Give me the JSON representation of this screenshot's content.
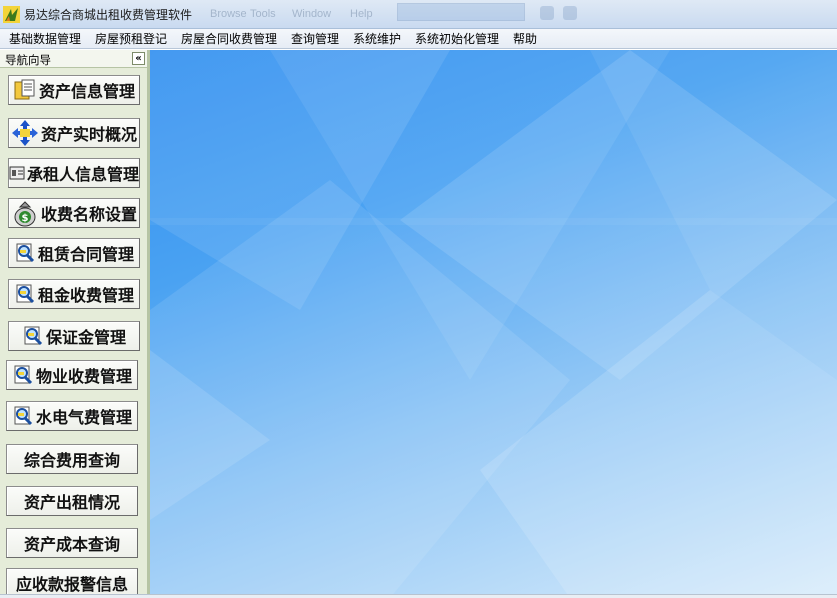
{
  "window": {
    "title": "易达综合商城出租收费管理软件"
  },
  "ghost_toolbar": {
    "items": [
      "Browse",
      "Tools",
      "Window",
      "Help"
    ]
  },
  "menu": {
    "items": [
      {
        "label": "基础数据管理",
        "name": "menu-basic-data"
      },
      {
        "label": "房屋预租登记",
        "name": "menu-pre-rent"
      },
      {
        "label": "房屋合同收费管理",
        "name": "menu-contract-fee"
      },
      {
        "label": "查询管理",
        "name": "menu-query"
      },
      {
        "label": "系统维护",
        "name": "menu-maintenance"
      },
      {
        "label": "系统初始化管理",
        "name": "menu-init"
      },
      {
        "label": "帮助",
        "name": "menu-help"
      }
    ]
  },
  "nav": {
    "title": "导航向导",
    "collapse_glyph": "«",
    "buttons": [
      {
        "label": "资产信息管理",
        "icon": "folder-document-icon"
      },
      {
        "label": "资产实时概况",
        "icon": "move-arrows-icon"
      },
      {
        "label": "承租人信息管理",
        "icon": "id-card-icon"
      },
      {
        "label": "收费名称设置",
        "icon": "money-bag-icon"
      },
      {
        "label": "租赁合同管理",
        "icon": "search-document-icon"
      },
      {
        "label": "租金收费管理",
        "icon": "search-document-icon"
      },
      {
        "label": "保证金管理",
        "icon": "search-document-icon"
      },
      {
        "label": "物业收费管理",
        "icon": "search-document-icon"
      },
      {
        "label": "水电气费管理",
        "icon": "search-document-icon"
      },
      {
        "label": "综合费用查询",
        "icon": ""
      },
      {
        "label": "资产出租情况",
        "icon": ""
      },
      {
        "label": "资产成本查询",
        "icon": ""
      },
      {
        "label": "应收款报警信息",
        "icon": ""
      }
    ]
  },
  "colors": {
    "nav_bg": "#e5ecd9",
    "main_top": "#2f8ef0",
    "main_bottom": "#d9ecfb"
  }
}
